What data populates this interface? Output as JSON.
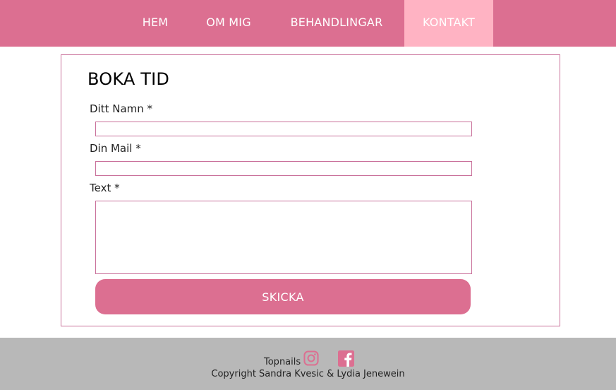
{
  "nav": {
    "items": [
      {
        "label": "HEM"
      },
      {
        "label": "OM MIG"
      },
      {
        "label": "BEHANDLINGAR"
      },
      {
        "label": "KONTAKT",
        "active": true
      }
    ]
  },
  "form": {
    "title": "BOKA TID",
    "name_label": "Ditt Namn *",
    "name_value": "",
    "mail_label": "Din Mail *",
    "mail_value": "",
    "text_label": "Text *",
    "text_value": "",
    "submit_label": "SKICKA"
  },
  "footer": {
    "brand": "Topnails",
    "instagram_icon": "instagram-icon",
    "facebook_icon": "facebook-icon",
    "copyright": "Copyright Sandra Kvesic & Lydia Jenewein"
  },
  "colors": {
    "accent": "#dc6f91",
    "active_tab": "#ffb3c3",
    "border": "#c9709a",
    "footer_bg": "#b8b8b8"
  }
}
